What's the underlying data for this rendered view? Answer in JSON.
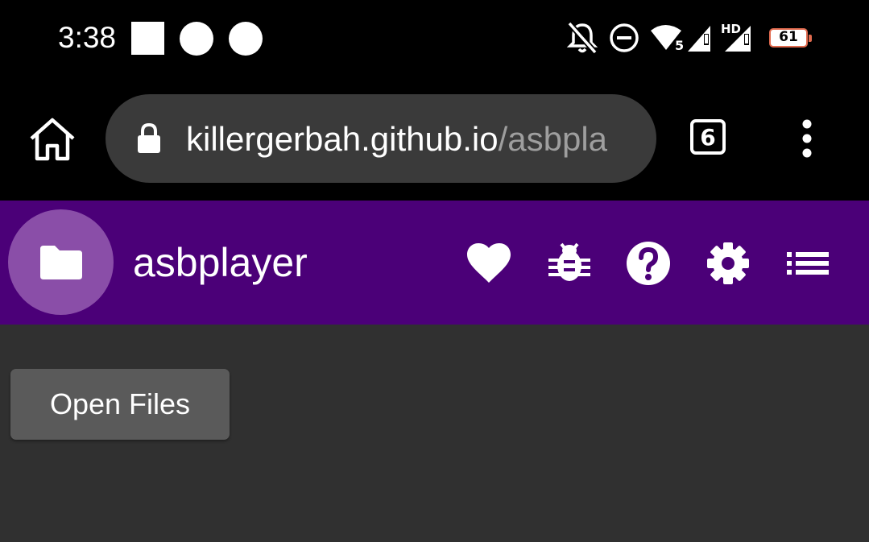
{
  "status_bar": {
    "time": "3:38",
    "icons": [
      "notification-square-icon",
      "notification-dot-icon",
      "notification-dot-icon",
      "bell-off-icon",
      "do-not-disturb-icon",
      "wifi-icon",
      "signal-icon",
      "signal-hd-icon",
      "battery-icon"
    ],
    "wifi_badge": "5",
    "hd_label": "HD",
    "battery_level": "61"
  },
  "browser": {
    "url_host": "killergerbah.github.io",
    "url_path": "/asbpla",
    "tab_count": "6"
  },
  "app_bar": {
    "title": "asbplayer",
    "accent_color": "#4b0078",
    "actions": [
      "heart-icon",
      "bug-icon",
      "help-icon",
      "settings-icon",
      "playlist-icon"
    ]
  },
  "main": {
    "open_files_label": "Open Files"
  }
}
